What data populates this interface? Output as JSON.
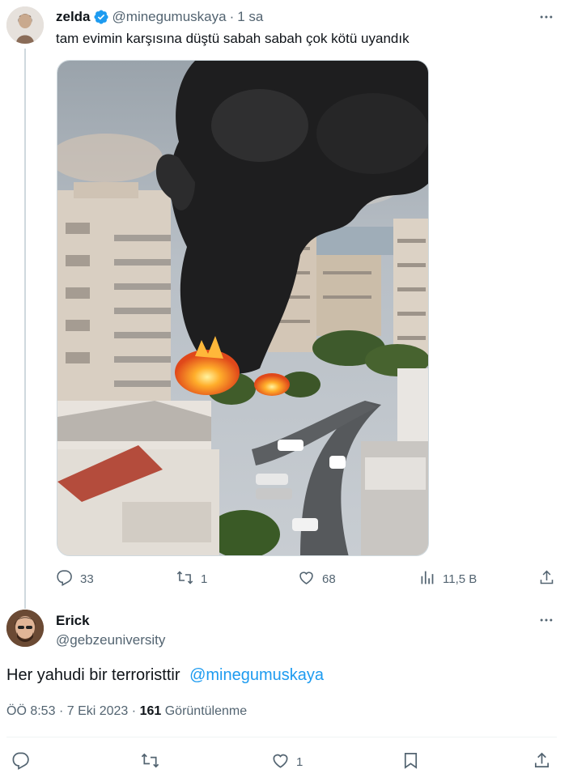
{
  "tweet1": {
    "name": "zelda",
    "handle": "@minegumuskaya",
    "time": "1 sa",
    "text": "tam evimin karşısına düştü sabah sabah çok kötü uyandık",
    "replies": "33",
    "reposts": "1",
    "likes": "68",
    "views": "11,5 B"
  },
  "tweet2": {
    "name": "Erick",
    "handle": "@gebzeuniversity",
    "text": "Her yahudi bir terroristtir",
    "mention": "@minegumuskaya",
    "time": "ÖÖ 8:53",
    "date": "7 Eki 2023",
    "views_count": "161",
    "views_label": "Görüntülenme",
    "likes": "1"
  },
  "colors": {
    "accent": "#1d9bf0",
    "muted": "#536471",
    "text": "#0f1419",
    "divider": "#eff3f4"
  },
  "icons": [
    "verified-badge-icon",
    "more-icon",
    "reply-icon",
    "repost-icon",
    "like-icon",
    "views-icon",
    "share-icon",
    "bookmark-icon"
  ]
}
